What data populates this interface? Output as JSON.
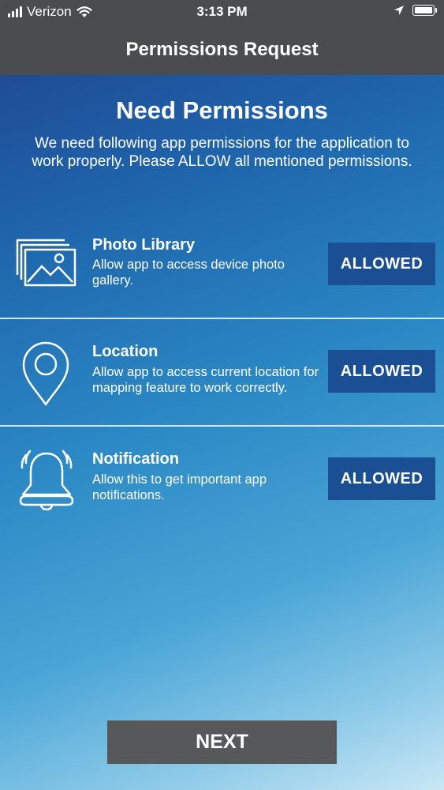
{
  "status_bar": {
    "carrier": "Verizon",
    "time": "3:13 PM",
    "icons": [
      "signal-icon",
      "wifi-icon",
      "location-arrow-icon",
      "battery-icon"
    ]
  },
  "nav": {
    "title": "Permissions Request"
  },
  "main": {
    "heading": "Need Permissions",
    "intro": "We need following app permissions for the application to work properly. Please ALLOW all mentioned permissions.",
    "permissions": [
      {
        "title": "Photo Library",
        "description": "Allow app to access device photo gallery.",
        "button": "ALLOWED",
        "icon": "photo-library-icon"
      },
      {
        "title": "Location",
        "description": "Allow app to access current location for mapping feature to work correctly.",
        "button": "ALLOWED",
        "icon": "location-pin-icon"
      },
      {
        "title": "Notification",
        "description": "Allow this to get important app notifications.",
        "button": "ALLOWED",
        "icon": "bell-icon"
      }
    ],
    "next_label": "NEXT"
  },
  "colors": {
    "bar": "#4b4c4d",
    "button_blue": "#1b4f94",
    "next_button": "#575859",
    "gradient_top": "#1f4c95",
    "gradient_bottom": "#c9e7f4"
  }
}
